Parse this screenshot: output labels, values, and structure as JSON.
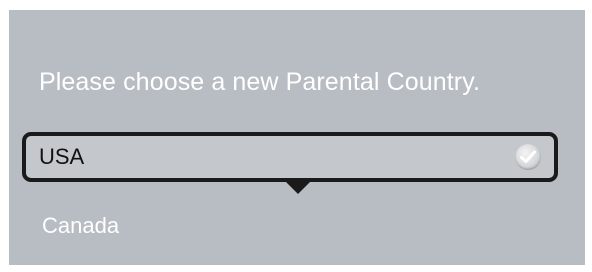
{
  "dialog": {
    "prompt": "Please choose a new Parental Country."
  },
  "country_list": {
    "options": [
      {
        "label": "USA",
        "selected": true
      },
      {
        "label": "Canada",
        "selected": false
      }
    ],
    "selected_icon": "checkmark-icon"
  },
  "colors": {
    "panel_background": "#b8bcc3",
    "selection_border": "#1a1a1a",
    "text_on_panel": "#ffffff",
    "selected_text": "#111111"
  }
}
